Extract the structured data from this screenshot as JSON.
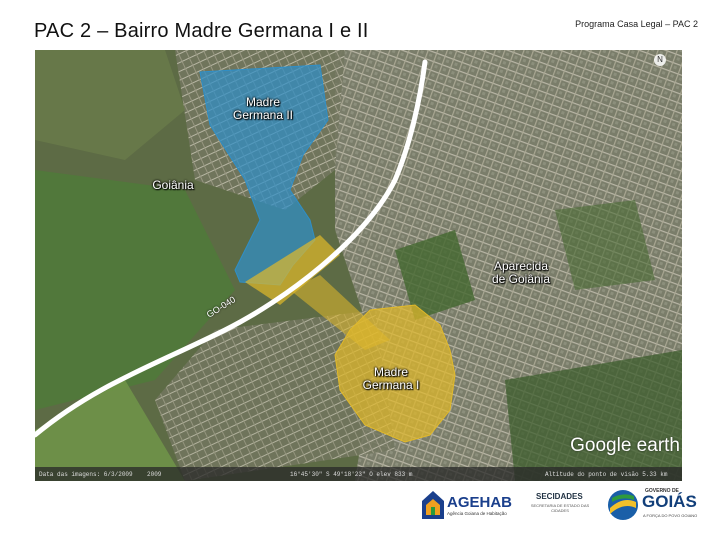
{
  "header": {
    "title": "PAC 2 – Bairro Madre Germana I e II",
    "program": "Programa Casa Legal – PAC 2"
  },
  "map": {
    "labels": {
      "madre_germana_ii": "Madre\nGermana II",
      "goiania": "Goiânia",
      "aparecida": "Aparecida\nde Goiânia",
      "madre_germana_i": "Madre\nGermana I",
      "road": "GO-040"
    },
    "watermark": "Google earth",
    "status": {
      "imagery_date": "Data das imagens: 6/3/2009",
      "year": "2009",
      "coords": "16°45'30\" S  49°18'23\" O  elev 833 m",
      "eye_alt": "Altitude do ponto de visão  5.33 km"
    },
    "colors": {
      "zone_ii": "#2f8fc8",
      "zone_i": "#e1b92a",
      "road": "#ffffff"
    }
  },
  "footer": {
    "agehab": "AGEHAB",
    "agehab_sub": "Agência Goiana de Habitação",
    "secidades": "SECIDADES",
    "secidades_sub": "SECRETARIA DE ESTADO DAS CIDADES",
    "goias_top": "GOVERNO DE",
    "goias": "GOIÁS",
    "goias_sub": "A FORÇA DO POVO GOIANO"
  }
}
